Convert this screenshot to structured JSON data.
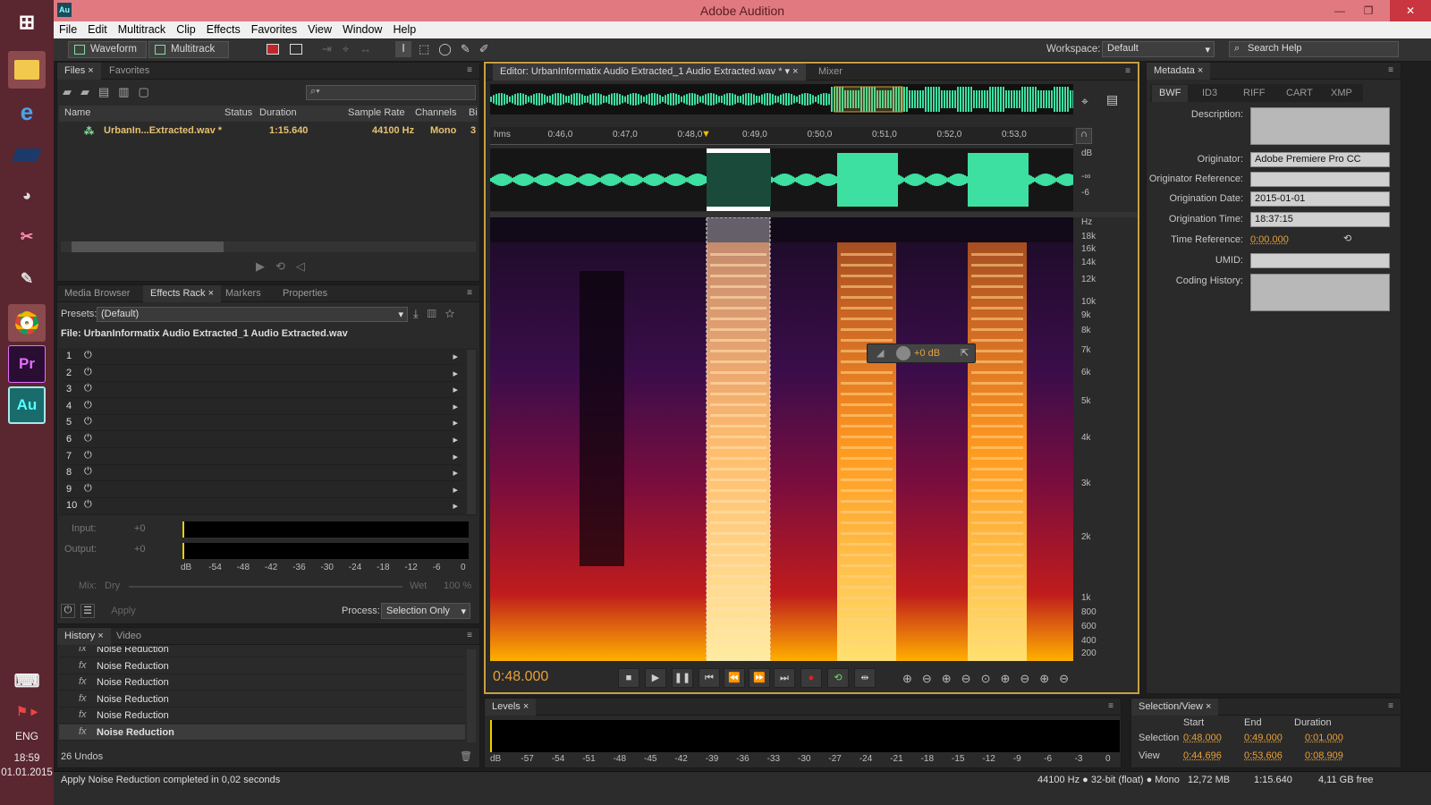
{
  "app": {
    "title": "Adobe Audition",
    "logo": "Au"
  },
  "menu": [
    "File",
    "Edit",
    "Multitrack",
    "Clip",
    "Effects",
    "Favorites",
    "View",
    "Window",
    "Help"
  ],
  "toolbar": {
    "waveform": "Waveform",
    "multitrack": "Multitrack",
    "workspace_label": "Workspace:",
    "workspace_value": "Default",
    "search_placeholder": "Search Help"
  },
  "files": {
    "tabs": [
      "Files",
      "Favorites"
    ],
    "columns": [
      "Name",
      "Status",
      "Duration",
      "Sample Rate",
      "Channels",
      "Bi"
    ],
    "file": {
      "name": "UrbanIn...Extracted.wav *",
      "duration": "1:15.640",
      "sample_rate": "44100 Hz",
      "channels": "Mono",
      "bits": "3"
    }
  },
  "effects": {
    "tabs": [
      "Media Browser",
      "Effects Rack",
      "Markers",
      "Properties"
    ],
    "presets_label": "Presets:",
    "presets_value": "(Default)",
    "file_line": "File: UrbanInformatix Audio Extracted_1 Audio Extracted.wav",
    "slots": [
      "1",
      "2",
      "3",
      "4",
      "5",
      "6",
      "7",
      "8",
      "9",
      "10"
    ],
    "input_label": "Input:",
    "output_label": "Output:",
    "gain": "+0",
    "meter_ticks": [
      "dB",
      "-54",
      "-48",
      "-42",
      "-36",
      "-30",
      "-24",
      "-18",
      "-12",
      "-6",
      "0"
    ],
    "mix_label": "Mix:",
    "dry": "Dry",
    "wet": "Wet",
    "wet_value": "100 %",
    "apply": "Apply",
    "process_label": "Process:",
    "process_value": "Selection Only"
  },
  "history": {
    "tabs": [
      "History",
      "Video"
    ],
    "items": [
      "Noise Reduction",
      "Noise Reduction",
      "Noise Reduction",
      "Noise Reduction",
      "Noise Reduction",
      "Noise Reduction"
    ],
    "undos": "26 Undos"
  },
  "editor": {
    "tabs": [
      "Editor: UrbanInformatix Audio Extracted_1 Audio Extracted.wav *",
      "Mixer"
    ],
    "time_ruler": [
      "hms",
      "0:46,0",
      "0:47,0",
      "0:48,0",
      "0:49,0",
      "0:50,0",
      "0:51,0",
      "0:52,0",
      "0:53,0"
    ],
    "db_labels": [
      "dB",
      "-∞",
      "-6"
    ],
    "hz_labels": [
      "Hz",
      "18k",
      "16k",
      "14k",
      "12k",
      "10k",
      "9k",
      "8k",
      "7k",
      "6k",
      "5k",
      "4k",
      "3k",
      "2k",
      "1k",
      "800",
      "600",
      "400",
      "200"
    ],
    "hud_value": "+0 dB",
    "current_time": "0:48.000"
  },
  "metadata": {
    "tabs": [
      "Metadata"
    ],
    "subtabs": [
      "BWF",
      "ID3",
      "RIFF",
      "CART",
      "XMP"
    ],
    "fields": [
      {
        "label": "Description:",
        "value": ""
      },
      {
        "label": "Originator:",
        "value": "Adobe Premiere Pro CC"
      },
      {
        "label": "Originator Reference:",
        "value": ""
      },
      {
        "label": "Origination Date:",
        "value": "2015-01-01"
      },
      {
        "label": "Origination Time:",
        "value": "18:37:15"
      },
      {
        "label": "Time Reference:",
        "value": "0:00.000"
      },
      {
        "label": "UMID:",
        "value": ""
      },
      {
        "label": "Coding History:",
        "value": ""
      }
    ]
  },
  "levels": {
    "tab": "Levels",
    "ticks": [
      "dB",
      "-57",
      "-54",
      "-51",
      "-48",
      "-45",
      "-42",
      "-39",
      "-36",
      "-33",
      "-30",
      "-27",
      "-24",
      "-21",
      "-18",
      "-15",
      "-12",
      "-9",
      "-6",
      "-3",
      "0"
    ]
  },
  "selection": {
    "tab": "Selection/View",
    "headers": [
      "Start",
      "End",
      "Duration"
    ],
    "rows": [
      {
        "label": "Selection",
        "start": "0:48.000",
        "end": "0:49.000",
        "duration": "0:01.000"
      },
      {
        "label": "View",
        "start": "0:44.696",
        "end": "0:53.606",
        "duration": "0:08.909"
      }
    ]
  },
  "status": {
    "message": "Apply Noise Reduction completed in 0,02 seconds",
    "format": "44100 Hz ● 32-bit (float) ● Mono",
    "size": "12,72 MB",
    "duration": "1:15.640",
    "free": "4,11 GB free"
  },
  "system": {
    "lang": "ENG",
    "time": "18:59",
    "date": "01.01.2015"
  }
}
